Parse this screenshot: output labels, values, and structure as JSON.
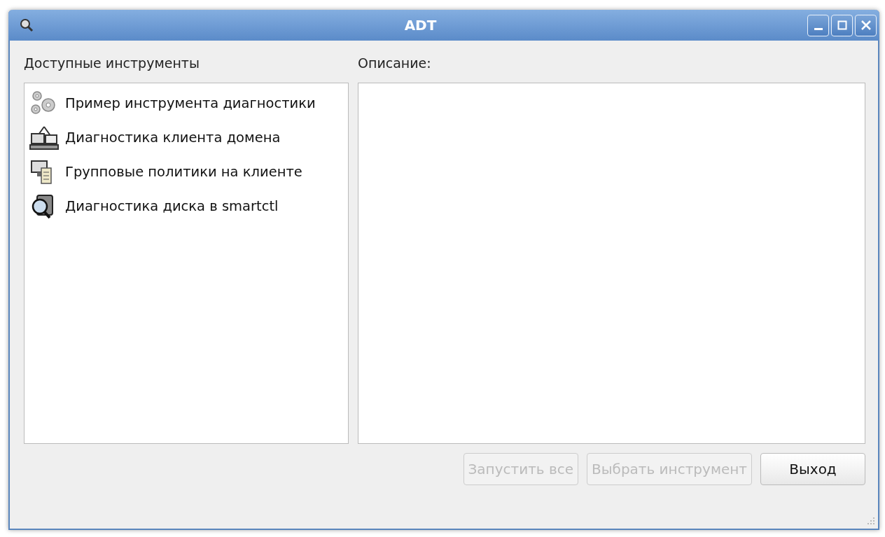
{
  "window": {
    "title": "ADT"
  },
  "tools": {
    "label": "Доступные инструменты",
    "items": [
      {
        "kind": "gears",
        "label": "Пример инструмента диагностики"
      },
      {
        "kind": "network",
        "label": "Диагностика клиента домена"
      },
      {
        "kind": "policy",
        "label": "Групповые политики на клиенте"
      },
      {
        "kind": "disk",
        "label": "Диагностика диска в smartctl"
      }
    ]
  },
  "description": {
    "label": "Описание:"
  },
  "buttons": [
    {
      "label": "Запустить все",
      "disabled": true
    },
    {
      "label": "Выбрать инструмент",
      "disabled": true
    },
    {
      "label": "Выход",
      "disabled": false
    }
  ]
}
